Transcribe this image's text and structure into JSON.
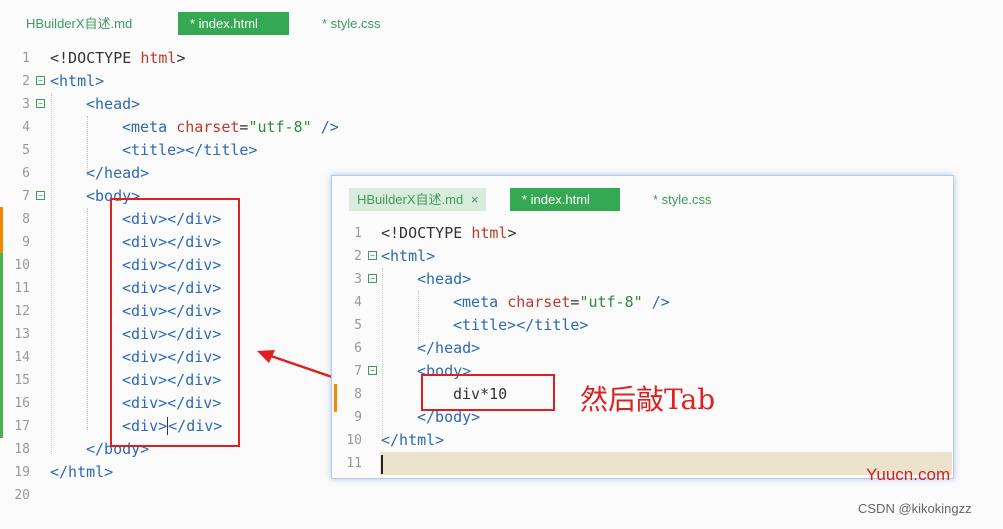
{
  "main_editor": {
    "tabs": [
      "HBuilderX自述.md",
      "* index.html",
      "* style.css"
    ],
    "lines": [
      {
        "n": "1"
      },
      {
        "n": "2"
      },
      {
        "n": "3"
      },
      {
        "n": "4"
      },
      {
        "n": "5"
      },
      {
        "n": "6"
      },
      {
        "n": "7"
      },
      {
        "n": "8"
      },
      {
        "n": "9"
      },
      {
        "n": "10"
      },
      {
        "n": "11"
      },
      {
        "n": "12"
      },
      {
        "n": "13"
      },
      {
        "n": "14"
      },
      {
        "n": "15"
      },
      {
        "n": "16"
      },
      {
        "n": "17"
      },
      {
        "n": "18"
      },
      {
        "n": "19"
      },
      {
        "n": "20"
      }
    ]
  },
  "popup_editor": {
    "tabs": [
      "HBuilderX自述.md",
      "* index.html",
      "* style.css"
    ],
    "close_glyph": "×",
    "line_numbers": [
      "1",
      "2",
      "3",
      "4",
      "5",
      "6",
      "7",
      "8",
      "9",
      "10",
      "11"
    ],
    "typed_text": "div*10"
  },
  "caption": "然后敲Tab",
  "watermark": "Yuucn.com",
  "credit": "CSDN @kikokingzz",
  "colors": {
    "accent": "#34a853",
    "highlight_box": "#e02020",
    "tag": "#2b6ab4",
    "attr": "#c0392b",
    "string": "#2f8a3c"
  }
}
